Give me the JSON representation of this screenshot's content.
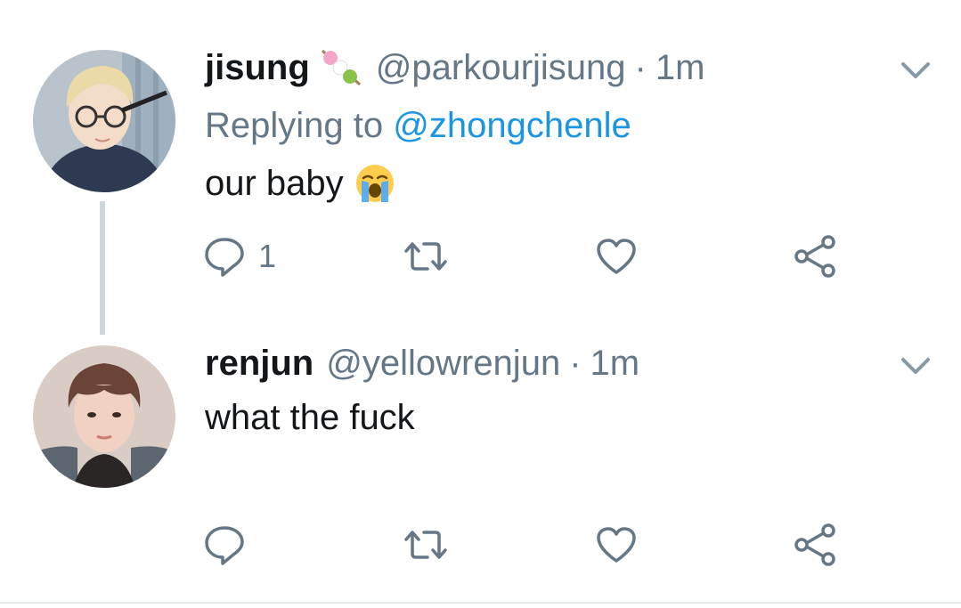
{
  "colors": {
    "text": "#14171a",
    "secondary": "#657786",
    "mention": "#1b95e0",
    "thread_line": "#ccd6dd"
  },
  "tweets": [
    {
      "display_name": "jisung",
      "name_emoji": "dango-emoji",
      "handle": "@parkourjisung",
      "separator": "·",
      "time": "1m",
      "replying_label": "Replying to",
      "replying_to": "@zhongchenle",
      "text": "our baby",
      "text_emoji": "loudly-crying-face-emoji",
      "actions": {
        "reply_count": "1",
        "retweet_count": "",
        "like_count": ""
      }
    },
    {
      "display_name": "renjun",
      "handle": "@yellowrenjun",
      "separator": "·",
      "time": "1m",
      "text": "what the fuck",
      "actions": {
        "reply_count": "",
        "retweet_count": "",
        "like_count": ""
      }
    }
  ]
}
